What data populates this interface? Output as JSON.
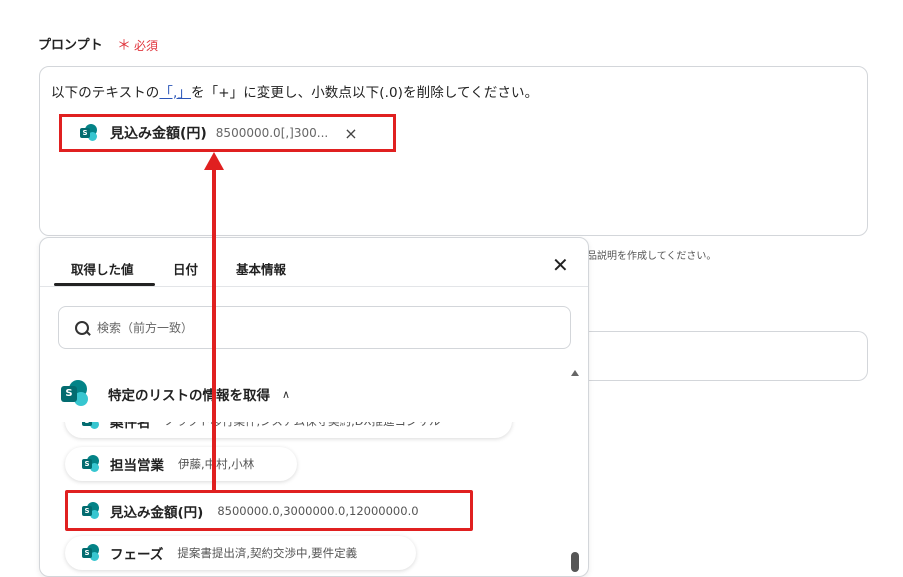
{
  "field": {
    "label": "プロンプト",
    "required_star": "＊",
    "required_text": "必須"
  },
  "prompt": {
    "text_before": "以下のテキストの",
    "quoted_char": "「,」",
    "text_after": "を「+」に変更し、小数点以下(.0)を削除してください。",
    "chip_name": "見込み金額(円)",
    "chip_value": "8500000.0[,]300...",
    "chip_remove": "×"
  },
  "background": {
    "hint_text": "品説明を作成してください。"
  },
  "popup": {
    "tabs": [
      "取得した値",
      "日付",
      "基本情報"
    ],
    "close": "✕",
    "search_placeholder": "検索（前方一致）",
    "group_label": "特定のリストの情報を取得",
    "group_chevron": "^",
    "items": [
      {
        "name": "案件名",
        "value": "ノラクト移行案件,ンスアム保守契約,DX推進コンサル"
      },
      {
        "name": "担当営業",
        "value": "伊藤,中村,小林"
      },
      {
        "name": "見込み金額(円)",
        "value": "8500000.0,3000000.0,12000000.0"
      },
      {
        "name": "フェーズ",
        "value": "提案書提出済,契約交渉中,要件定義"
      }
    ]
  },
  "colors": {
    "highlight": "#e02020",
    "required": "#e0363e",
    "sharepoint_dark": "#036c70",
    "sharepoint_mid": "#038387",
    "sharepoint_light": "#37c6d0"
  },
  "icons": {
    "list_item": "sharepoint-icon",
    "search": "search-icon",
    "close": "close-icon",
    "chip_remove": "close-icon",
    "group_toggle": "chevron-up-icon"
  }
}
